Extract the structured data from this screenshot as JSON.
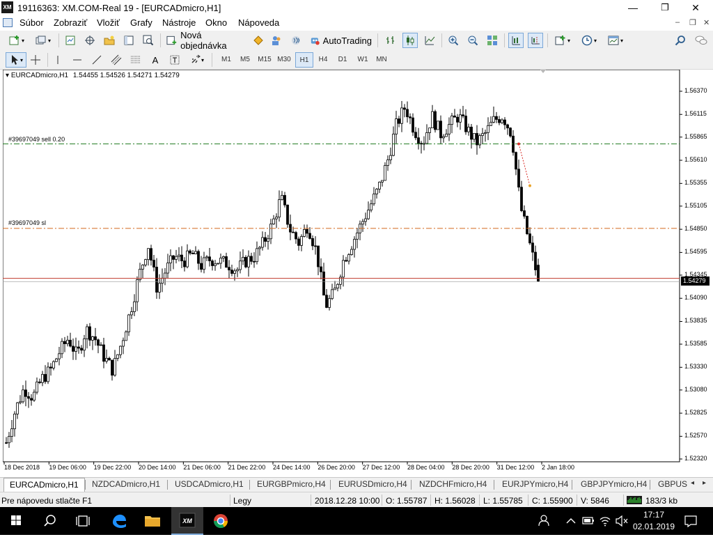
{
  "window": {
    "logo_text": "XM",
    "title": "19116363: XM.COM-Real 19 - [EURCADmicro,H1]",
    "minimize": "—",
    "maximize": "❐",
    "close": "✕"
  },
  "menu": {
    "items": [
      "Súbor",
      "Zobraziť",
      "Vložiť",
      "Grafy",
      "Nástroje",
      "Okno",
      "Nápoveda"
    ],
    "mdi_min": "–",
    "mdi_restore": "❐",
    "mdi_close": "✕"
  },
  "toolbar": {
    "new_order": "Nová objednávka",
    "autotrading": "AutoTrading",
    "timeframes": [
      "M1",
      "M5",
      "M15",
      "M30",
      "H1",
      "H4",
      "D1",
      "W1",
      "MN"
    ],
    "selected_timeframe": "H1",
    "text_tool": "A"
  },
  "chart": {
    "symbol_info": "EURCADmicro,H1",
    "ohlc": "1.54455 1.54526 1.54271 1.54279",
    "orders": [
      {
        "label": "#39697049 sell 0.20",
        "price": 1.5579,
        "color": "#1f7a1f"
      },
      {
        "label": "#39697049 sl",
        "price": 1.5486,
        "color": "#d2691e"
      }
    ],
    "bid_line": {
      "price": 1.54279,
      "color": "#c0392b"
    },
    "current_price_label": "1.54279",
    "price_ticks": [
      "1.56370",
      "1.56115",
      "1.55865",
      "1.55610",
      "1.55355",
      "1.55105",
      "1.54850",
      "1.54595",
      "1.54345",
      "1.54090",
      "1.53835",
      "1.53585",
      "1.53330",
      "1.53080",
      "1.52825",
      "1.52570",
      "1.52320"
    ],
    "date_ticks": [
      "18 Dec 2018",
      "19 Dec 06:00",
      "19 Dec 22:00",
      "20 Dec 14:00",
      "21 Dec 06:00",
      "21 Dec 22:00",
      "24 Dec 14:00",
      "26 Dec 20:00",
      "27 Dec 12:00",
      "28 Dec 04:00",
      "28 Dec 20:00",
      "31 Dec 12:00",
      "2 Jan 18:00"
    ]
  },
  "chart_data": {
    "type": "candlestick",
    "symbol": "EURCADmicro",
    "timeframe": "H1",
    "ylim": [
      1.5226,
      1.565
    ],
    "trend_closes": [
      1.525,
      1.5285,
      1.531,
      1.53,
      1.532,
      1.533,
      1.535,
      1.5365,
      1.5345,
      1.5375,
      1.5365,
      1.5345,
      1.533,
      1.536,
      1.5395,
      1.5435,
      1.5468,
      1.542,
      1.544,
      1.5455,
      1.545,
      1.5458,
      1.5445,
      1.5452,
      1.545,
      1.5447,
      1.544,
      1.545,
      1.5455,
      1.547,
      1.549,
      1.552,
      1.5485,
      1.547,
      1.549,
      1.546,
      1.54,
      1.5415,
      1.545,
      1.547,
      1.549,
      1.551,
      1.553,
      1.556,
      1.56,
      1.562,
      1.5595,
      1.558,
      1.561,
      1.559,
      1.56,
      1.561,
      1.5595,
      1.558,
      1.559,
      1.5605,
      1.561,
      1.559,
      1.551,
      1.547,
      1.543
    ],
    "last": {
      "open": 1.54455,
      "high": 1.54526,
      "low": 1.54271,
      "close": 1.54279
    }
  },
  "tabs": {
    "items": [
      "EURCADmicro,H1",
      "NZDCADmicro,H1",
      "USDCADmicro,H1",
      "EURGBPmicro,H4",
      "EURUSDmicro,H4",
      "NZDCHFmicro,H4",
      "EURJPYmicro,H4",
      "GBPJPYmicro,H4",
      "GBPUSD"
    ],
    "active": "EURCADmicro,H1",
    "scroll_left": "◂",
    "scroll_right": "▸"
  },
  "status": {
    "help": "Pre nápovedu stlačte F1",
    "profile": "Legy",
    "datetime": "2018.12.28 10:00",
    "open": "O: 1.55787",
    "high": "H: 1.56028",
    "low": "L: 1.55785",
    "close": "C: 1.55900",
    "volume": "V: 5846",
    "traffic": "183/3 kb"
  },
  "taskbar": {
    "time": "17:17",
    "date": "02.01.2019"
  }
}
